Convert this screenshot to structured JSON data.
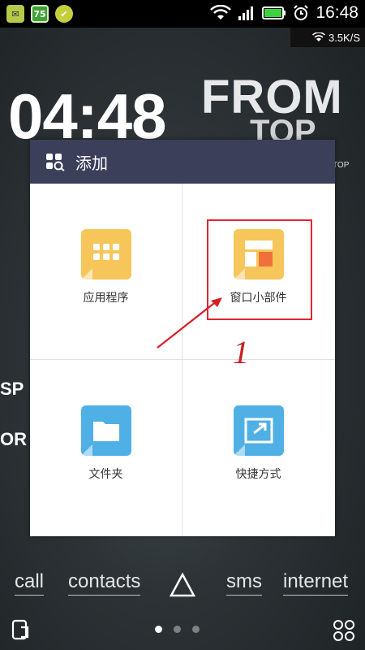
{
  "status_bar": {
    "time": "16:48",
    "badge_75": "75",
    "net_speed": "3.5K/S"
  },
  "wallpaper": {
    "clock": "04:48",
    "from_text": "FROM",
    "top_text": "TOP",
    "top_small": "TOP",
    "side_text_1": "SP",
    "side_text_2": "OR"
  },
  "dialog": {
    "title": "添加",
    "options": [
      {
        "label": "应用程序",
        "icon": "apps-grid-icon"
      },
      {
        "label": "窗口小部件",
        "icon": "widget-icon"
      },
      {
        "label": "文件夹",
        "icon": "folder-icon"
      },
      {
        "label": "快捷方式",
        "icon": "shortcut-icon"
      }
    ]
  },
  "annotation": {
    "number": "1",
    "color": "#e0262e"
  },
  "dock": {
    "items": [
      "call",
      "contacts",
      "sms",
      "internet"
    ]
  },
  "colors": {
    "dialog_header": "#3b3f5a",
    "tile_yellow": "#f6c65a",
    "tile_blue": "#4fb0e6"
  }
}
